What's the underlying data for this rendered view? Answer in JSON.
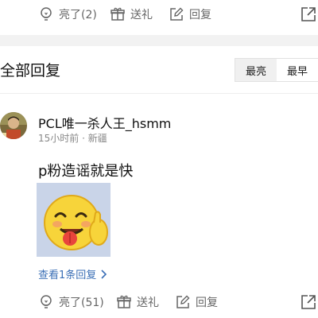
{
  "top_actions": {
    "like_label": "亮了(2)",
    "gift_label": "送礼",
    "reply_label": "回复"
  },
  "section": {
    "title": "全部回复",
    "sort_options": [
      "最亮",
      "最早"
    ],
    "selected_sort": "最亮"
  },
  "post": {
    "username": "PCL唯一杀人王_hsmm",
    "meta": "15小时前 · 新疆",
    "text": "p粉造谣就是快",
    "view_replies": "查看1条回复"
  },
  "bottom_actions": {
    "like_label": "亮了(51)",
    "gift_label": "送礼",
    "reply_label": "回复"
  },
  "icons": {
    "like": "lightbulb-icon",
    "gift": "gift-icon",
    "reply": "edit-icon",
    "share": "share-icon",
    "chevron": "chevron-right-icon"
  },
  "colors": {
    "link": "#3b6fb6",
    "icon_gray": "#666666",
    "divider": "#f2f2f2"
  }
}
